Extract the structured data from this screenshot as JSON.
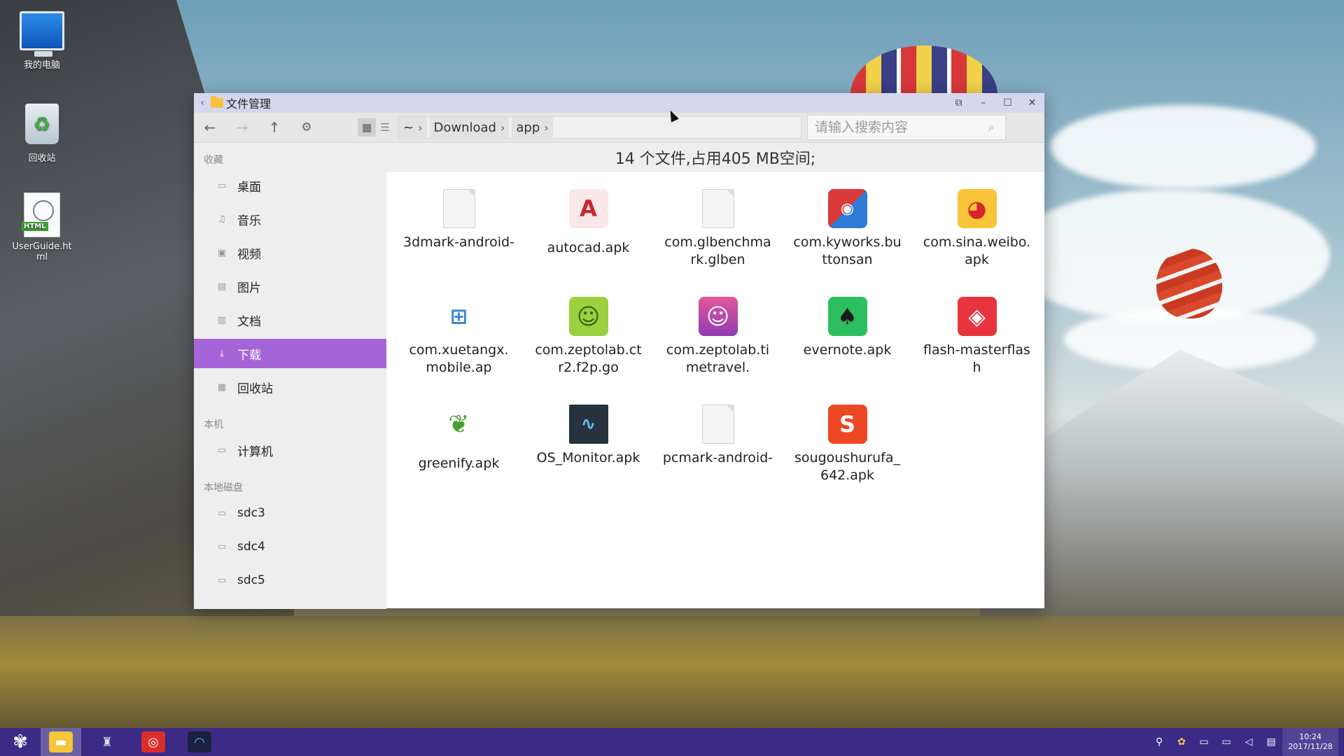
{
  "desktop": {
    "icons": [
      {
        "label": "我的电脑",
        "icon": "computer-icon"
      },
      {
        "label": "回收站",
        "icon": "recycle-bin-icon"
      },
      {
        "label": "UserGuide.html",
        "icon": "html-file-icon"
      }
    ]
  },
  "window": {
    "title": "文件管理",
    "controls": [
      "restore-icon",
      "minimize-icon",
      "maximize-icon",
      "close-icon"
    ]
  },
  "toolbar": {
    "breadcrumb": [
      "~",
      "Download",
      "app"
    ],
    "search_placeholder": "请输入搜索内容"
  },
  "sidebar": {
    "sections": [
      {
        "header": "收藏",
        "items": [
          "桌面",
          "音乐",
          "视频",
          "图片",
          "文档",
          "下载",
          "回收站"
        ]
      },
      {
        "header": "本机",
        "items": [
          "计算机"
        ]
      },
      {
        "header": "本地磁盘",
        "items": [
          "sdc3",
          "sdc4",
          "sdc5"
        ]
      }
    ],
    "active_item": "下载"
  },
  "main": {
    "summary": "14 个文件,占用405 MB空间;",
    "files": [
      {
        "name": "3dmark-android-",
        "icon": "blank-document-icon"
      },
      {
        "name": "autocad.apk",
        "icon": "autocad-icon"
      },
      {
        "name": "com.glbenchmark.glben",
        "icon": "blank-document-icon"
      },
      {
        "name": "com.kyworks.buttonsan",
        "icon": "buttons-game-icon"
      },
      {
        "name": "com.sina.weibo.apk",
        "icon": "weibo-icon"
      },
      {
        "name": "com.xuetangx.mobile.ap",
        "icon": "xuetangx-icon"
      },
      {
        "name": "com.zeptolab.ctr2.f2p.go",
        "icon": "cut-the-rope-icon"
      },
      {
        "name": "com.zeptolab.timetravel.",
        "icon": "cut-the-rope-timetravel-icon"
      },
      {
        "name": "evernote.apk",
        "icon": "evernote-icon"
      },
      {
        "name": "flash-masterflash",
        "icon": "flash-icon"
      },
      {
        "name": "greenify.apk",
        "icon": "greenify-icon"
      },
      {
        "name": "OS_Monitor.apk",
        "icon": "os-monitor-icon"
      },
      {
        "name": "pcmark-android-",
        "icon": "blank-document-icon"
      },
      {
        "name": "sougoushurufa_642.apk",
        "icon": "sogou-input-icon"
      }
    ]
  },
  "taskbar": {
    "apps": [
      "start-icon",
      "file-manager-icon",
      "eagle-icon",
      "netease-music-icon",
      "speedtest-icon"
    ],
    "clock_time": "10:24",
    "clock_date": "2017/11/28"
  },
  "colors": {
    "accent": "#a565d8",
    "titlebar": "#d7d6ef",
    "taskbar": "#3b2b86"
  }
}
